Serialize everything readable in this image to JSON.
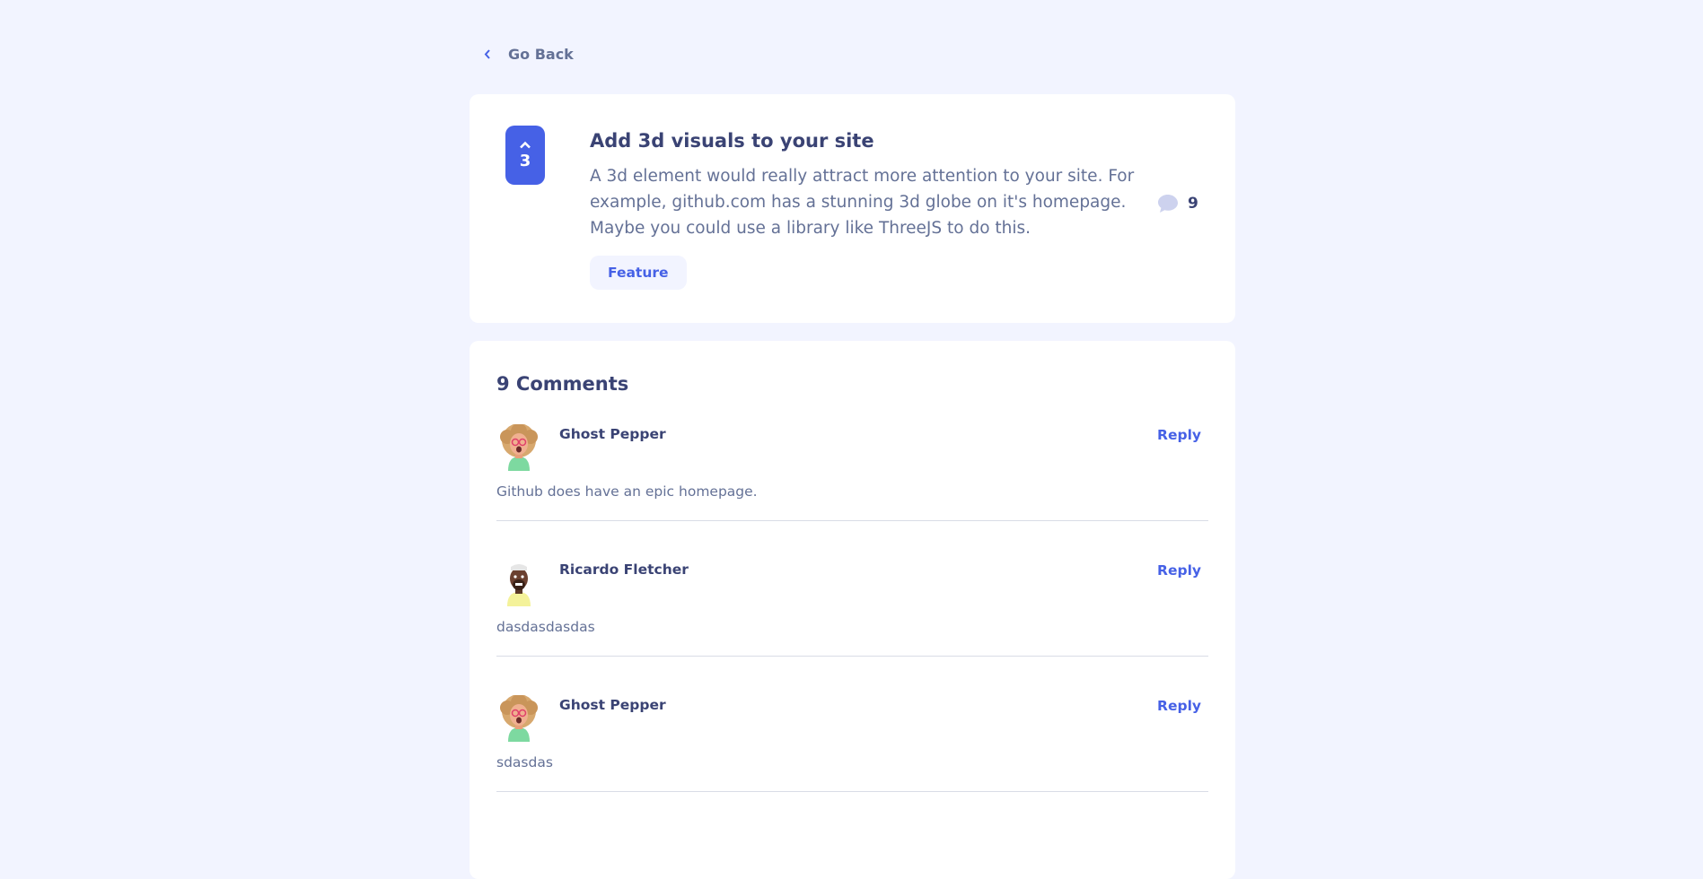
{
  "nav": {
    "go_back_label": "Go Back"
  },
  "feedback": {
    "upvotes": "3",
    "title": "Add 3d visuals to your site",
    "description": "A 3d element would really attract more attention to your site. For example, github.com has a stunning 3d globe on it's homepage. Maybe you could use a library like ThreeJS to do this.",
    "category": "Feature",
    "comment_count": "9"
  },
  "comments_section": {
    "title": "9 Comments",
    "comments": [
      {
        "author": "Ghost Pepper",
        "reply_label": "Reply",
        "text": "Github does have an epic homepage."
      },
      {
        "author": "Ricardo Fletcher",
        "reply_label": "Reply",
        "text": "dasdasdasdas"
      },
      {
        "author": "Ghost Pepper",
        "reply_label": "Reply",
        "text": "sdasdas"
      }
    ]
  },
  "colors": {
    "background": "#F2F4FF",
    "card": "#FFFFFF",
    "accent": "#4661E6",
    "heading": "#3A4374",
    "body_text": "#647196"
  }
}
